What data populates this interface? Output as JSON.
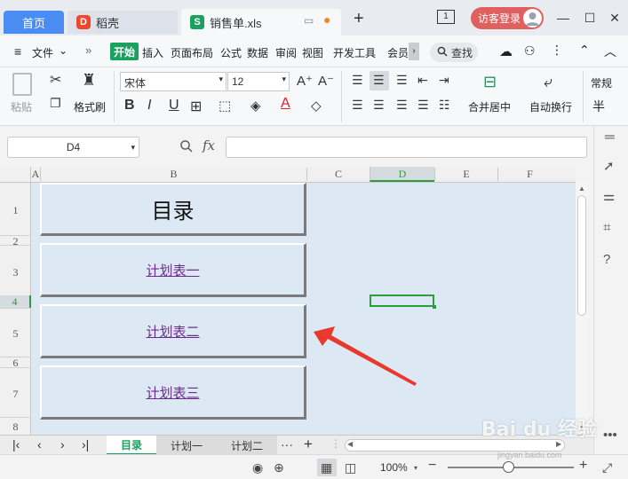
{
  "tabs": {
    "home": "首页",
    "daoke": "稻壳",
    "file": "销售单.xls",
    "new_tab": "+"
  },
  "titlebar": {
    "login": "访客登录",
    "page_badge": "1"
  },
  "menu": {
    "file": "文件",
    "start": "开始",
    "insert": "插入",
    "page_layout": "页面布局",
    "formula": "公式",
    "data": "数据",
    "review": "审阅",
    "view": "视图",
    "developer": "开发工具",
    "member": "会员",
    "search": "查找"
  },
  "ribbon": {
    "paste": "粘贴",
    "format_painter": "格式刷",
    "font_name": "宋体",
    "font_size": "12",
    "merge_center": "合并居中",
    "wrap_text": "自动换行",
    "number_format": "常规",
    "currency": "半"
  },
  "formula_bar": {
    "cell_ref": "D4",
    "fx": "fx",
    "value": ""
  },
  "columns": [
    "A",
    "B",
    "C",
    "D",
    "E",
    "F"
  ],
  "rows": [
    "1",
    "2",
    "3",
    "4",
    "5",
    "6",
    "7",
    "8"
  ],
  "cells": {
    "title": "目录",
    "link1": "计划表一",
    "link2": "计划表二",
    "link3": "计划表三"
  },
  "sheets": {
    "tab1": "目录",
    "tab2": "计划一",
    "tab3": "计划二",
    "more": "···",
    "add": "+"
  },
  "status": {
    "zoom": "100%"
  },
  "watermark": {
    "main": "Bai du 经验",
    "sub": "jingyan.baidu.com"
  },
  "colors": {
    "accent": "#1aa15f",
    "home_tab": "#4a8cf2",
    "login": "#e06060",
    "sheet_bg": "#dce9f5",
    "link": "#6b2a8a",
    "arrow": "#e8392c"
  }
}
